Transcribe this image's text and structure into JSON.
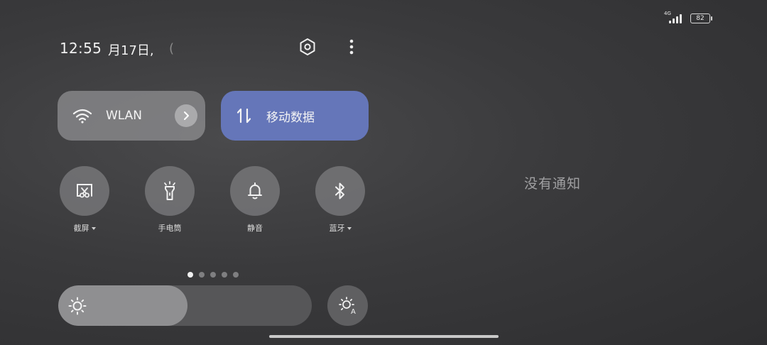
{
  "status_bar": {
    "network_label": "4G",
    "battery_level": "82",
    "signal_icon": "signal-bars-icon",
    "battery_icon": "battery-icon"
  },
  "header": {
    "time": "12:55",
    "date": "月17日,",
    "date_overflow": "(",
    "settings_icon": "hexagon-settings-icon",
    "more_icon": "vertical-dots-icon"
  },
  "tiles": {
    "wlan": {
      "label": "WLAN",
      "icon": "wifi-icon",
      "expand_icon": "chevron-right-icon",
      "active": false
    },
    "mobile_data": {
      "label": "移动数据",
      "icon": "up-down-arrows-icon",
      "active": true,
      "active_color": "#6576b9"
    }
  },
  "toggles": [
    {
      "label": "截屏",
      "icon": "screenshot-icon",
      "has_dropdown": true
    },
    {
      "label": "手电筒",
      "icon": "flashlight-icon",
      "has_dropdown": false
    },
    {
      "label": "静音",
      "icon": "bell-icon",
      "has_dropdown": false
    },
    {
      "label": "蓝牙",
      "icon": "bluetooth-icon",
      "has_dropdown": true
    }
  ],
  "pager": {
    "count": 5,
    "active_index": 0
  },
  "brightness": {
    "level_percent": 51,
    "icon": "sun-icon",
    "auto_icon": "auto-brightness-icon"
  },
  "notifications": {
    "empty_text": "没有通知"
  }
}
